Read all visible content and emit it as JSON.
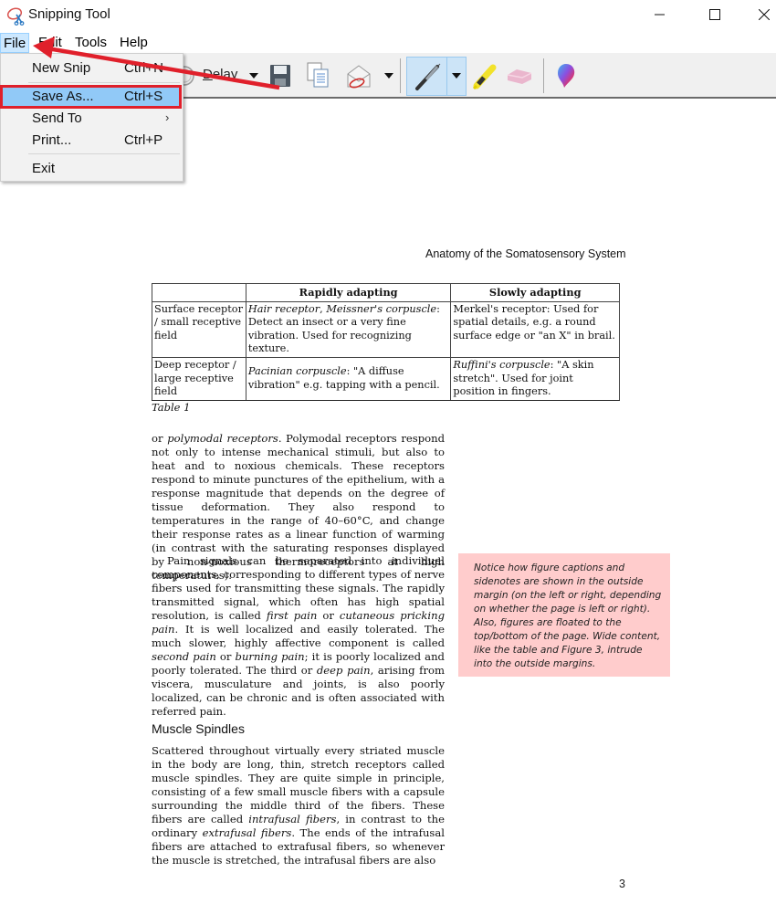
{
  "window": {
    "title": "Snipping Tool",
    "controls": {
      "minimize": "minimize",
      "maximize": "maximize",
      "close": "close"
    }
  },
  "menubar": {
    "items": [
      "File",
      "Edit",
      "Tools",
      "Help"
    ],
    "active": "File"
  },
  "toolbar": {
    "delay_prefix": "D",
    "delay_rest": "elay",
    "icons": [
      "new-snip-icon",
      "delay-clock-icon",
      "save-icon",
      "copy-icon",
      "send-snip-icon",
      "pen-icon",
      "highlighter-icon",
      "eraser-icon",
      "paint3d-icon"
    ],
    "active_tool": "pen"
  },
  "file_menu": {
    "items": [
      {
        "label": "New Snip",
        "shortcut": "Ctrl+N"
      },
      {
        "label": "Save As...",
        "shortcut": "Ctrl+S",
        "highlighted": true
      },
      {
        "label": "Send To",
        "shortcut": "",
        "submenu": true
      },
      {
        "label": "Print...",
        "shortcut": "Ctrl+P"
      },
      {
        "label": "Exit",
        "shortcut": ""
      }
    ],
    "submenu_arrow": "›"
  },
  "annotation": {
    "highlight_color": "#e0202b",
    "arrow_color": "#e0202b"
  },
  "document": {
    "running_head": "Anatomy of the Somatosensory System",
    "table": {
      "headers": [
        "",
        "Rapidly adapting",
        "Slowly adapting"
      ],
      "rows": [
        {
          "label": "Surface receptor / small receptive field",
          "rapid_italic_1": "Hair receptor",
          "rapid_sep": ", ",
          "rapid_italic_2": "Meissner's corpuscle",
          "rapid_rest": ": Detect an insect or a very fine vibration. Used for recognizing texture.",
          "slow": "Merkel's receptor: Used for spatial details, e.g. a round surface edge or \"an X\" in brail."
        },
        {
          "label": "Deep receptor / large receptive field",
          "rapid_italic_1": "Pacinian corpuscle",
          "rapid_rest": ": \"A diffuse vibration\" e.g. tapping with a pencil.",
          "slow_italic": "Ruffini's corpuscle",
          "slow_rest": ": \"A skin stretch\". Used for joint position in fingers."
        }
      ],
      "caption": "Table 1"
    },
    "paragraph1": {
      "a": "or ",
      "b_italic": "polymodal receptors",
      "c": ". Polymodal receptors respond not only to intense mechanical stimuli, but also to heat and to noxious chemicals. These receptors respond to minute punctures of the epithelium, with a response magnitude that depends on the degree of tissue deformation. They also respond to temperatures in the range of 40–60°C, and change their response rates as a linear function of warming (in contrast with the saturating responses displayed by non-noxious thermoreceptors at high temperatures)."
    },
    "paragraph2": {
      "a": "Pain signals can be separated into individual components, corresponding to different types of nerve fibers used for transmitting these signals. The rapidly transmitted signal, which often has high spatial resolution, is called ",
      "b_italic": "first pain",
      "c": " or ",
      "d_italic": "cutaneous pricking pain",
      "e": ". It is well localized and easily tolerated. The much slower, highly affective component is called ",
      "f_italic": "second pain",
      "g": " or ",
      "h_italic": "burning pain",
      "i": "; it is poorly localized and poorly tolerated. The third or ",
      "j_italic": "deep pain",
      "k": ", arising from viscera, musculature and joints, is also poorly localized, can be chronic and is often associated with referred pain."
    },
    "section_heading": "Muscle Spindles",
    "paragraph3": {
      "a": "Scattered throughout virtually every striated muscle in the body are long, thin, stretch receptors called muscle spindles. They are quite simple in principle, consisting of a few small muscle fibers with a capsule surrounding the middle third of the fibers. These fibers are called ",
      "b_italic": "intrafusal fibers",
      "c": ", in contrast to the ordinary ",
      "d_italic": "extrafusal fibers",
      "e": ". The ends of the intrafusal fibers are attached to extrafusal fibers, so whenever the muscle is stretched, the intrafusal fibers are also"
    },
    "sidenote": "Notice how figure captions and sidenotes are shown in the outside margin (on the left or right, depending on whether the page is left or right). Also, figures are floated to the top/bottom of the page. Wide content, like the table and Figure 3, intrude into the outside margins.",
    "page_number": "3"
  }
}
